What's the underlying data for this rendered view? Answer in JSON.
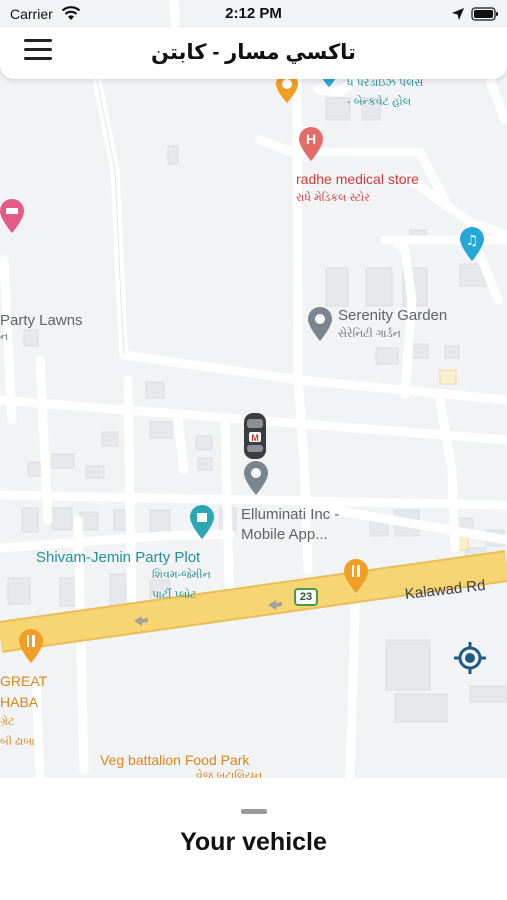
{
  "status_bar": {
    "carrier": "Carrier",
    "time": "2:12 PM",
    "wifi_icon": "wifi-icon",
    "location_icon": "location-arrow-icon",
    "battery_icon": "battery-icon"
  },
  "header": {
    "title": "تاكسي مسار - كابتن",
    "menu_icon": "hamburger-menu-icon"
  },
  "map": {
    "places": {
      "top_hall_sub_1": "ધ પરડાઇઝ પલસ",
      "top_hall_sub_2": "- બેન્કવેટ હોલ",
      "medical_name": "radhe medical store",
      "medical_sub": "રાધે મેડિકલ સ્ટોર",
      "party_lawns_name": "Party Lawns",
      "party_lawns_sub": "ન",
      "serenity_name": "Serenity Garden",
      "serenity_sub": "સેરેનિટી ગાર્ડન",
      "elluminati_name_1": "Elluminati Inc -",
      "elluminati_name_2": "Mobile App...",
      "shivam_name": "Shivam-Jemin Party Plot",
      "shivam_sub_1": "શિવમ-જેમીન",
      "shivam_sub_2": "પાર્ટી પ્લોટ",
      "road_name": "Kalawad Rd",
      "route_shield": "23",
      "great_name_1": "GREAT",
      "great_name_2": "HABA",
      "great_sub_1": "ગ્રેટ",
      "great_sub_2": "બી ઢાબા",
      "veg_name": "Veg battalion Food Park",
      "veg_sub": "વેજ બટાલિયન"
    },
    "colors": {
      "background": "#f2f3f5",
      "road_major": "#f7d572",
      "road_minor": "#ffffff",
      "restaurant_pin": "#f29d24",
      "medical_pin": "#e56b6b",
      "hotel_pin": "#e25b86",
      "music_pin": "#26a8d6",
      "place_pin": "#7b8590",
      "park_pin": "#2aa7b3"
    },
    "locate_icon": "crosshair-locate-icon",
    "vehicle_icon": "taxi-car-icon"
  },
  "bottom_sheet": {
    "title": "Your vehicle"
  }
}
